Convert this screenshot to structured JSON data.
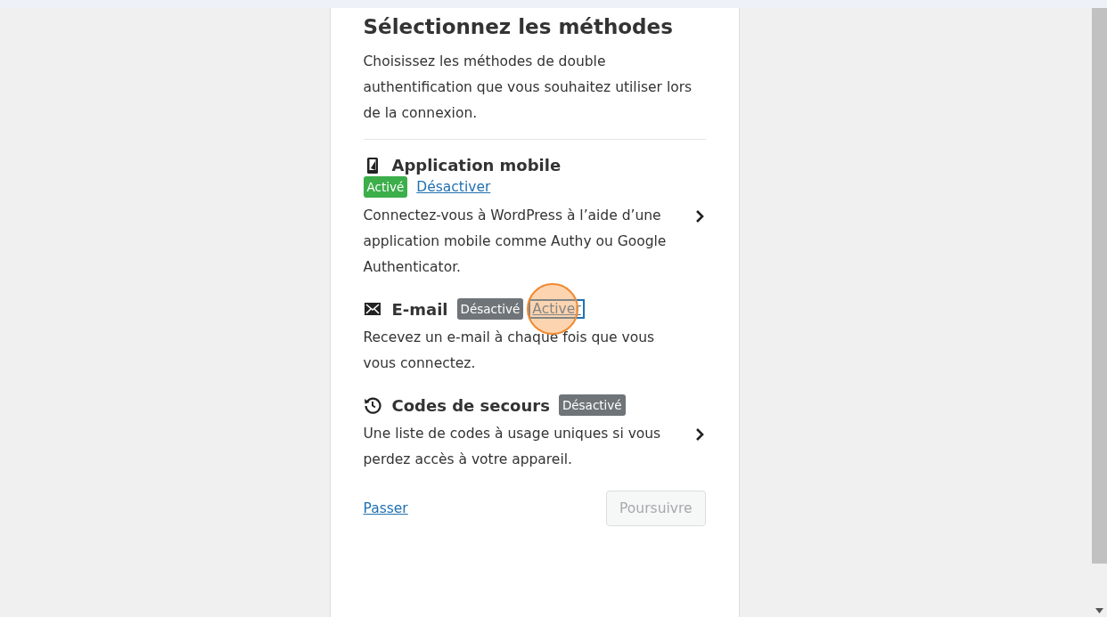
{
  "title": "Sélectionnez les méthodes",
  "intro": "Choisissez les méthodes de double authentification que vous souhaitez utiliser lors de la connexion.",
  "methods": [
    {
      "kind": "mobile",
      "name": "Application mobile",
      "status": {
        "label": "Activé",
        "active": true
      },
      "status_on_new_line": true,
      "action": {
        "label": "Désactiver",
        "focused": false,
        "click_marker": false
      },
      "description": "Connectez-vous à WordPress à l’aide d’une application mobile comme Authy ou Google Authenticator.",
      "chevron": true
    },
    {
      "kind": "email",
      "name": "E-mail",
      "status": {
        "label": "Désactivé",
        "active": false
      },
      "status_on_new_line": false,
      "action": {
        "label": "Activer",
        "focused": true,
        "click_marker": true
      },
      "description": "Recevez un e-mail à chaque fois que vous vous connectez.",
      "chevron": false
    },
    {
      "kind": "backup",
      "name": "Codes de secours",
      "status": {
        "label": "Désactivé",
        "active": false
      },
      "status_on_new_line": false,
      "description": "Une liste de codes à usage uniques si vous perdez accès à votre appareil.",
      "chevron": true
    }
  ],
  "skip_link": "Passer",
  "continue_button": {
    "label": "Poursuivre",
    "disabled": true
  }
}
